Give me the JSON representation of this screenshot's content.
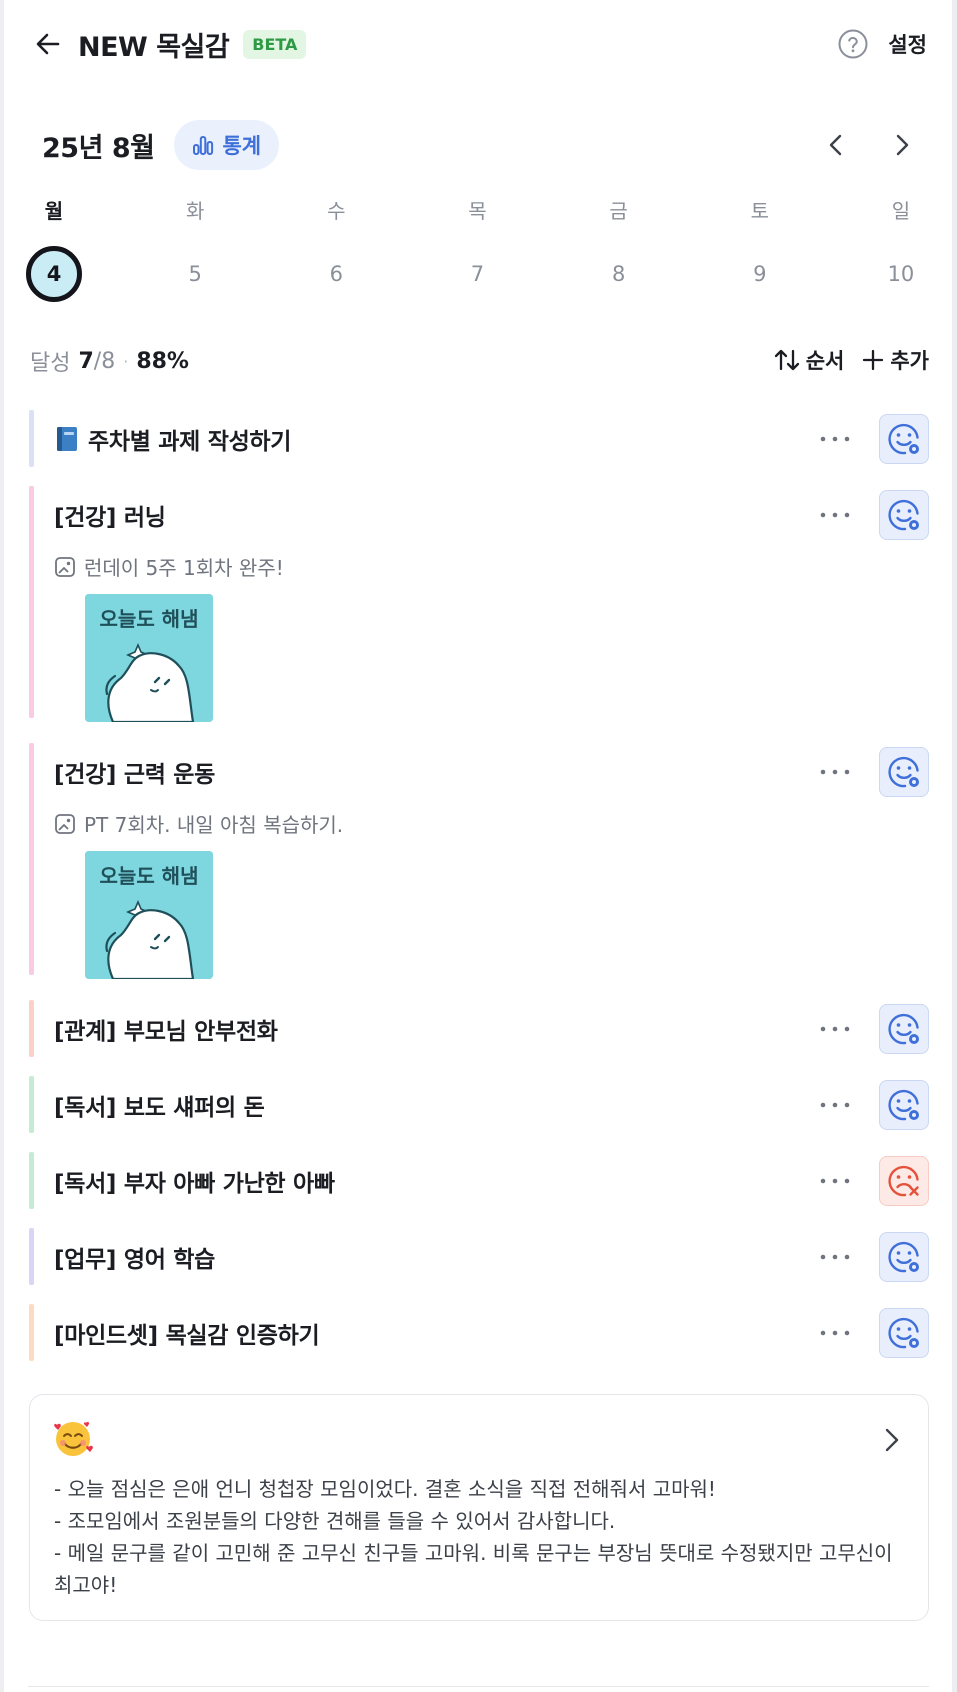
{
  "header": {
    "title": "NEW 목실감",
    "badge": "BETA",
    "settings_label": "설정",
    "icons": {
      "back": "arrow-left-icon",
      "help": "question-circle-icon"
    }
  },
  "calendar": {
    "month_label": "25년 8월",
    "stats_label": "통계",
    "weekdays": [
      "월",
      "화",
      "수",
      "목",
      "금",
      "토",
      "일"
    ],
    "dates": [
      "4",
      "5",
      "6",
      "7",
      "8",
      "9",
      "10"
    ],
    "selected_index": 0
  },
  "progress": {
    "label": "달성",
    "done": "7",
    "total": "/8",
    "separator": "·",
    "percent": "88%",
    "order_label": "순서",
    "add_label": "추가"
  },
  "tasks": [
    {
      "emoji": "blue-book-icon",
      "title": "주차별 과제 작성하기",
      "status": "done",
      "bar_color": "#d9e1f5"
    },
    {
      "title": "[건강] 러닝",
      "note": "런데이 5주 1회차 완주!",
      "sticker_text": "오늘도 해냄",
      "status": "done",
      "bar_color": "#f9c9e6"
    },
    {
      "title": "[건강] 근력 운동",
      "note": "PT 7회차. 내일 아침 복습하기.",
      "sticker_text": "오늘도 해냄",
      "status": "done",
      "bar_color": "#f9c9e6"
    },
    {
      "title": "[관계] 부모님 안부전화",
      "status": "done",
      "bar_color": "#fbd0c8"
    },
    {
      "title": "[독서] 보도 섀퍼의 돈",
      "status": "done",
      "bar_color": "#c3ecd3"
    },
    {
      "title": "[독서] 부자 아빠 가난한 아빠",
      "status": "failed",
      "bar_color": "#c3ecd3"
    },
    {
      "title": "[업무] 영어 학습",
      "status": "done",
      "bar_color": "#d7d6f7"
    },
    {
      "title": "[마인드셋] 목실감 인증하기",
      "status": "done",
      "bar_color": "#fbdcc0"
    }
  ],
  "diary": {
    "emoji": "smiling-face-with-hearts-icon",
    "lines": [
      "- 오늘 점심은 은애 언니 청첩장 모임이었다. 결혼 소식을 직접 전해줘서 고마워!",
      "- 조모임에서 조원분들의 다양한 견해를 들을 수 있어서 감사합니다.",
      "- 메일 문구를 같이 고민해 준 고무신 친구들 고마워. 비록 문구는 부장님 뜻대로 수정됐지만 고무신이 최고야!"
    ]
  },
  "colors": {
    "accent": "#3f6fd9",
    "fail": "#e4523b",
    "selected_date_fill": "#c9ecf5",
    "beta": "#2f9a45"
  }
}
